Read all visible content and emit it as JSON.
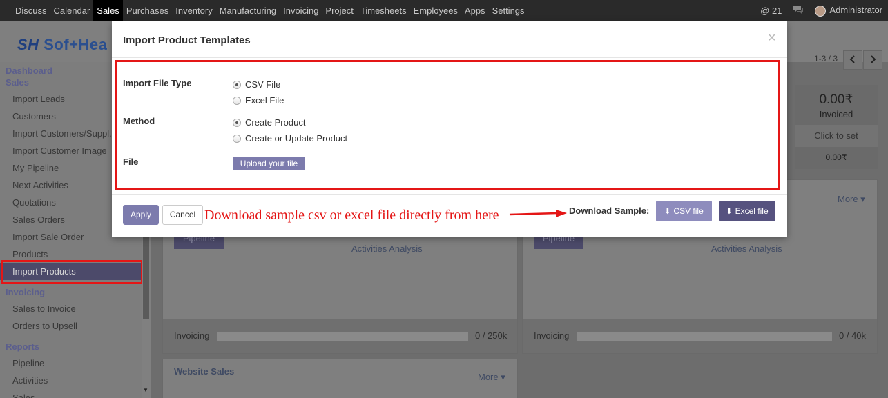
{
  "topbar": {
    "menu": [
      "Discuss",
      "Calendar",
      "Sales",
      "Purchases",
      "Inventory",
      "Manufacturing",
      "Invoicing",
      "Project",
      "Timesheets",
      "Employees",
      "Apps",
      "Settings"
    ],
    "active": "Sales",
    "notif_count": "21",
    "user": "Administrator"
  },
  "logo": {
    "text": "Sof+Hea"
  },
  "sidebar": {
    "sections": {
      "dashboard": "Dashboard",
      "sales": "Sales",
      "invoicing": "Invoicing",
      "reports": "Reports"
    },
    "sales_items": [
      "Import Leads",
      "Customers",
      "Import Customers/Suppl...",
      "Import Customer Image",
      "My Pipeline",
      "Next Activities",
      "Quotations",
      "Sales Orders",
      "Import Sale Order",
      "Products",
      "Import Products"
    ],
    "invoicing_items": [
      "Sales to Invoice",
      "Orders to Upsell"
    ],
    "reports_items": [
      "Pipeline",
      "Activities",
      "Sales"
    ]
  },
  "pager": {
    "text": "1-3 / 3"
  },
  "kpi": {
    "amount": "0.00₹",
    "label": "Invoiced",
    "click_to_set": "Click to set",
    "small": "0.00₹"
  },
  "cards": {
    "left": {
      "pipeline": "Pipeline",
      "activities": "Activities Analysis",
      "invoicing": "Invoicing",
      "value": "0 / 250k"
    },
    "right": {
      "more": "More",
      "pipeline": "Pipeline",
      "activities": "Activities Analysis",
      "invoicing": "Invoicing",
      "value": "0 / 40k"
    },
    "website": {
      "title": "Website Sales",
      "more": "More"
    }
  },
  "modal": {
    "title": "Import Product Templates",
    "close": "×",
    "import_file_type_label": "Import File Type",
    "file_types": [
      "CSV File",
      "Excel File"
    ],
    "method_label": "Method",
    "methods": [
      "Create Product",
      "Create or Update Product"
    ],
    "file_label": "File",
    "upload_label": "Upload your file",
    "apply_label": "Apply",
    "cancel_label": "Cancel",
    "annotation": "Download sample csv or excel file directly from here",
    "download_sample_label": "Download Sample:",
    "csv_btn": "CSV file",
    "excel_btn": "Excel file"
  },
  "colors": {
    "accent": "#7c7bad",
    "highlight": "#e41616"
  }
}
